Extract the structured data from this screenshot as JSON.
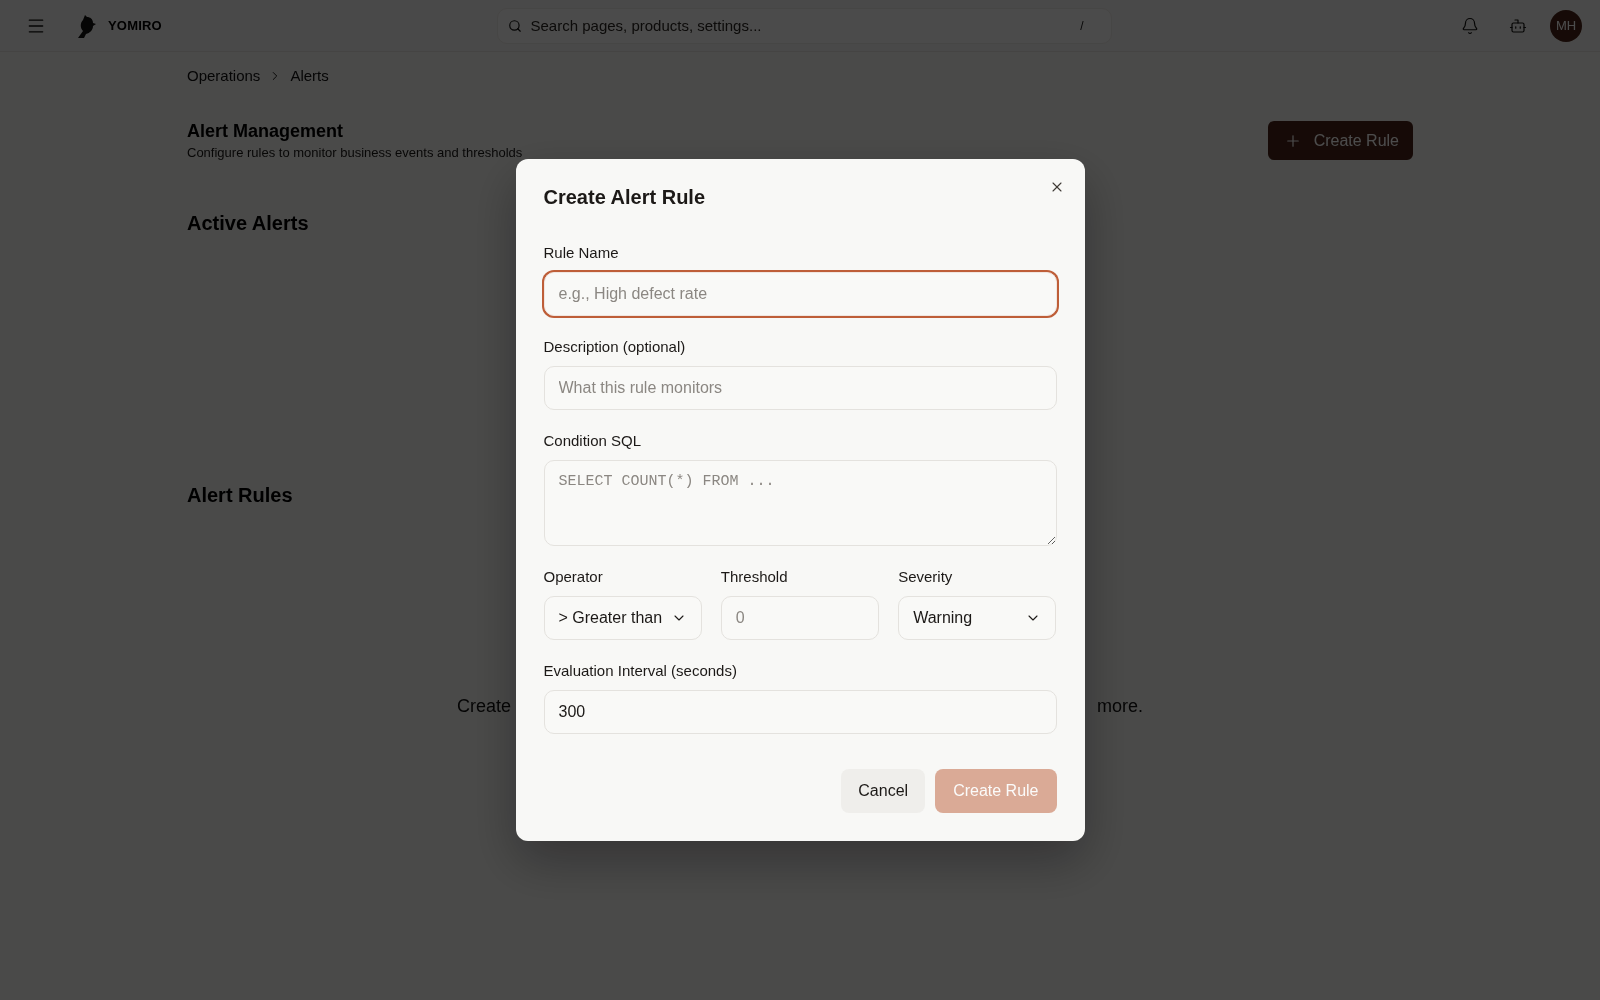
{
  "top_bar": {
    "brand": "YOMIRO",
    "search": {
      "placeholder": "Search pages, products, settings...",
      "shortcut": "/"
    },
    "avatar": {
      "initials": "MH"
    }
  },
  "breadcrumbs": [
    {
      "label": "Operations"
    },
    {
      "label": "Alerts"
    }
  ],
  "page_header": {
    "title": "Alert Management",
    "subtitle": "Configure rules to monitor business events and thresholds",
    "action": {
      "label": "Create Rule"
    }
  },
  "sections": [
    {
      "title": "Active Alerts"
    },
    {
      "title": "Alert Rules",
      "empty_message": {
        "start": "Create",
        "end": "more."
      }
    }
  ],
  "dialog": {
    "title": "Create Alert Rule",
    "rows": [
      {
        "fields": [
          {
            "kind": "text",
            "label": "Rule Name",
            "placeholder": "e.g., High defect rate",
            "focused": true
          }
        ]
      },
      {
        "fields": [
          {
            "kind": "text",
            "label": "Description (optional)",
            "placeholder": "What this rule monitors",
            "focused": false
          }
        ]
      },
      {
        "fields": [
          {
            "kind": "textarea",
            "label": "Condition SQL",
            "placeholder": "SELECT COUNT(*) FROM ...",
            "focused": false
          }
        ]
      },
      {
        "fields": [
          {
            "kind": "select",
            "label": "Operator",
            "value": "> Greater than",
            "focused": false
          },
          {
            "kind": "number",
            "label": "Threshold",
            "placeholder": "0",
            "focused": false
          },
          {
            "kind": "select",
            "label": "Severity",
            "value": "Warning",
            "focused": false
          }
        ]
      },
      {
        "fields": [
          {
            "kind": "number",
            "label": "Evaluation Interval (seconds)",
            "value": "300",
            "focused": false
          }
        ]
      }
    ],
    "buttons": [
      {
        "label": "Cancel",
        "kind": "secondary",
        "disabled": false
      },
      {
        "label": "Create Rule",
        "kind": "primary",
        "disabled": true
      }
    ]
  }
}
